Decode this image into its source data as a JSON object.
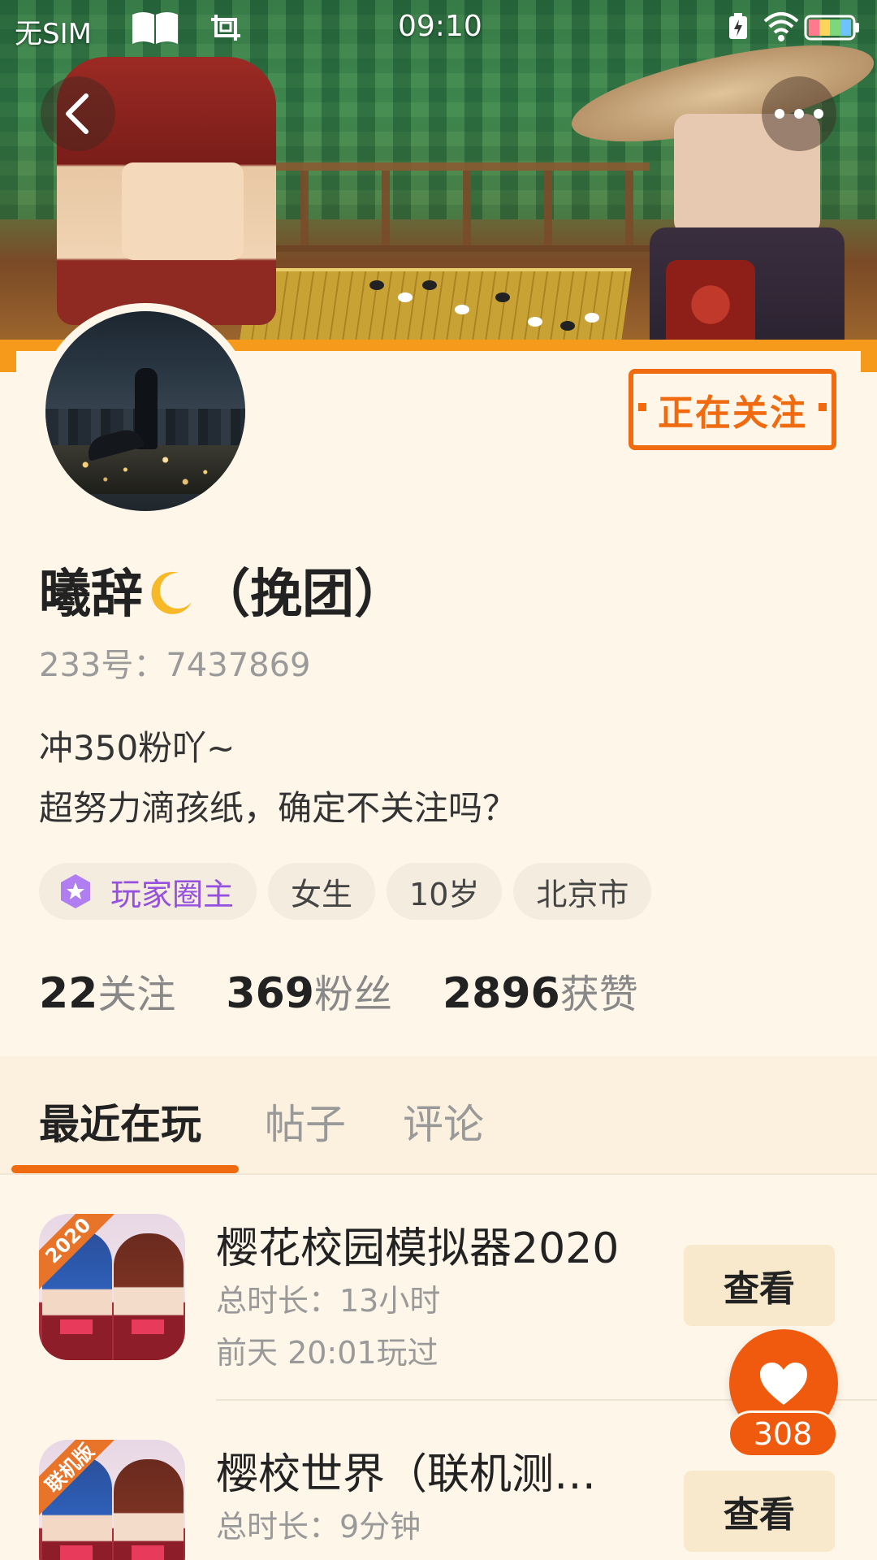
{
  "status_bar": {
    "carrier": "无SIM",
    "time": "09:10",
    "icons": [
      "book-icon",
      "screenshot-icon",
      "charging-icon",
      "wifi-icon",
      "battery-icon"
    ]
  },
  "header": {
    "back_icon": "chevron-left-icon",
    "more_icon": "more-dots-icon"
  },
  "profile": {
    "nickname_part1": "曦辞",
    "nickname_part2": "（挽团）",
    "user_id": "233号：7437869",
    "follow_button": "正在关注",
    "bio_line1": "冲350粉吖~",
    "bio_line2": "超努力滴孩纸，确定不关注吗？",
    "tags": {
      "creator": "玩家圈主",
      "gender": "女生",
      "age": "10岁",
      "city": "北京市"
    },
    "stats": {
      "following_count": "22",
      "following_label": "关注",
      "followers_count": "369",
      "followers_label": "粉丝",
      "likes_count": "2896",
      "likes_label": "获赞"
    }
  },
  "tabs": {
    "recent": "最近在玩",
    "posts": "帖子",
    "comments": "评论",
    "active": "recent"
  },
  "games": [
    {
      "title": "樱花校园模拟器2020",
      "duration": "总时长：13小时",
      "last_played": "前天 20:01玩过",
      "badge": "2020",
      "view_button": "查看"
    },
    {
      "title": "樱校世界（联机测…",
      "duration": "总时长：9分钟",
      "badge": "联机版",
      "view_button": "查看"
    }
  ],
  "like": {
    "count": "308"
  },
  "colors": {
    "accent_orange": "#f06a0f",
    "banner_orange": "#f59a1a",
    "background": "#fdf6e9",
    "creator_purple": "#9550e0"
  }
}
